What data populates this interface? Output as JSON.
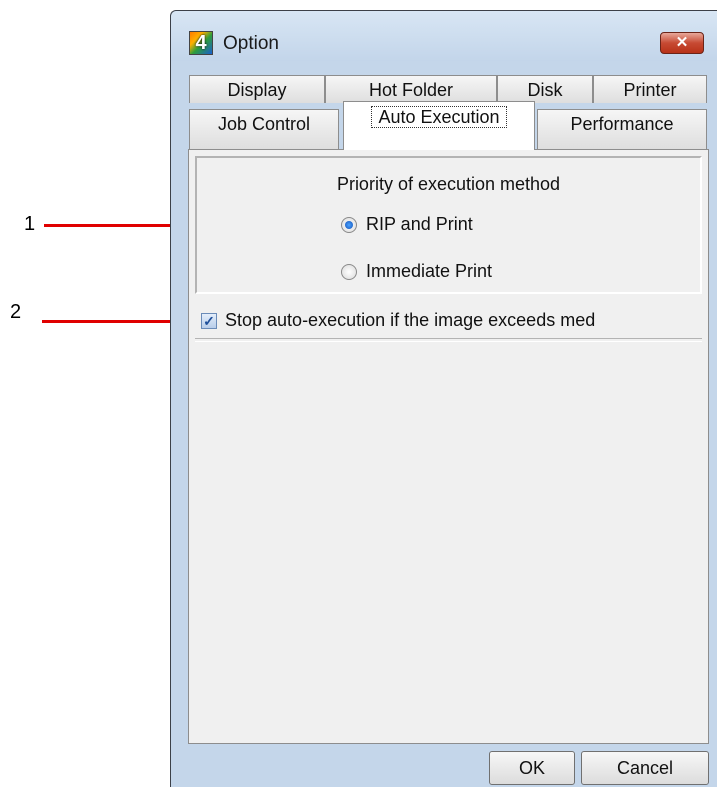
{
  "callouts": [
    {
      "num": "1"
    },
    {
      "num": "2"
    }
  ],
  "window": {
    "title": "Option",
    "icon_glyph": "4",
    "close_glyph": "✕"
  },
  "tabs": {
    "row1": [
      "Display",
      "Hot Folder",
      "Disk",
      "Printer"
    ],
    "row2": [
      "Job Control",
      "Auto Execution",
      "Performance"
    ],
    "active": "Auto Execution"
  },
  "group": {
    "title": "Priority of execution method",
    "options": [
      {
        "label": "RIP and Print",
        "selected": true
      },
      {
        "label": "Immediate Print",
        "selected": false
      }
    ]
  },
  "checkbox": {
    "label": "Stop auto-execution if the image exceeds med",
    "checked": true,
    "check_glyph": "✓"
  },
  "buttons": {
    "ok": "OK",
    "cancel": "Cancel"
  },
  "colors": {
    "callout_line": "#e00000",
    "window_frame": "#c4d6ea",
    "close_button": "#c74a33"
  }
}
